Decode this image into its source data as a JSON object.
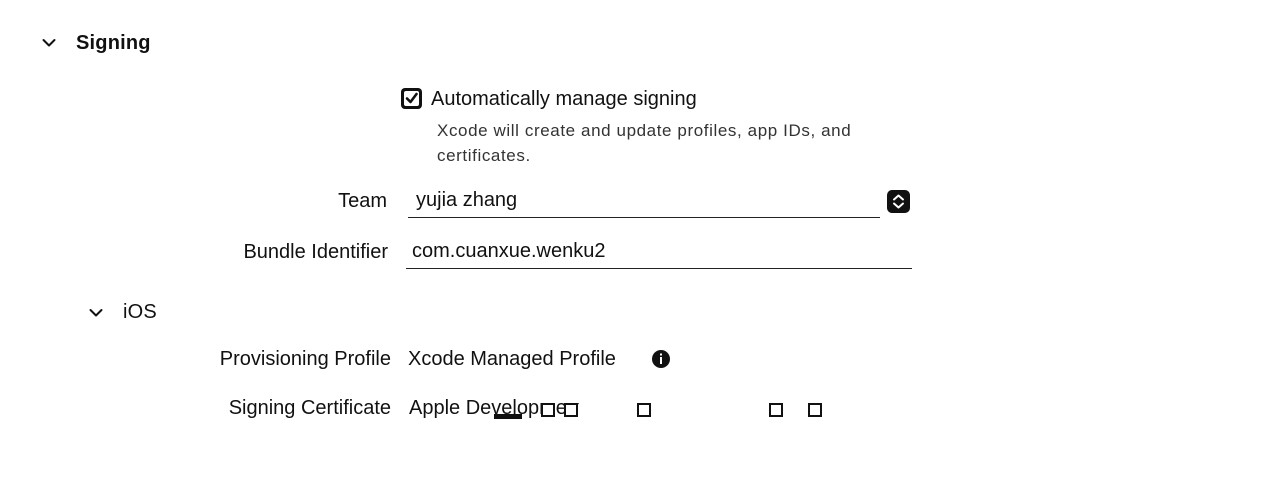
{
  "signing": {
    "section_title": "Signing",
    "auto_manage": {
      "checked": true,
      "label": "Automatically manage signing",
      "description": "Xcode will create and update profiles, app IDs, and certificates."
    },
    "team": {
      "label": "Team",
      "value": "yujia zhang"
    },
    "bundle_identifier": {
      "label": "Bundle Identifier",
      "value": "com.cuanxue.wenku2"
    }
  },
  "ios": {
    "section_title": "iOS",
    "provisioning_profile": {
      "label": "Provisioning Profile",
      "value": "Xcode Managed Profile"
    },
    "signing_certificate": {
      "label": "Signing Certificate",
      "value": "Apple Development"
    }
  },
  "icons": {
    "section_chevron": "chevron-down-icon",
    "checkbox": "checkmark-icon",
    "team_popup": "popup-stepper-icon",
    "profile_info": "info-icon"
  },
  "colors": {
    "text": "#111111",
    "secondary_text": "#333333",
    "background": "#ffffff"
  }
}
